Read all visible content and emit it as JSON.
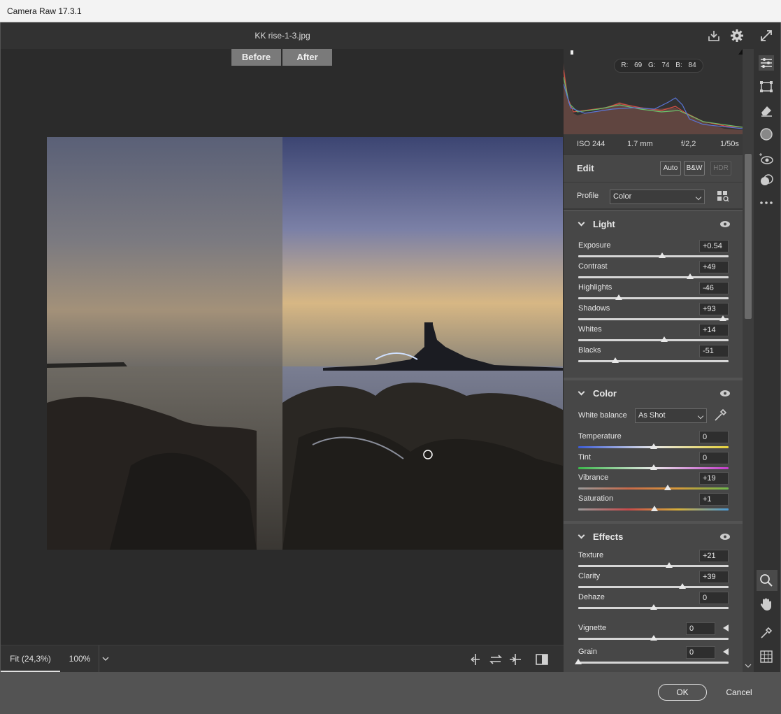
{
  "window": {
    "title": "Camera Raw 17.3.1"
  },
  "topbar": {
    "filename": "KK rise-1-3.jpg",
    "icons": [
      "save-download-icon",
      "settings-gear-icon",
      "fullscreen-icon"
    ]
  },
  "preview": {
    "before_label": "Before",
    "after_label": "After",
    "zoom_fit": "Fit (24,3%)",
    "zoom_100": "100%"
  },
  "histogram": {
    "r_label": "R: 69",
    "g_label": "G: 74",
    "b_label": "B: 84"
  },
  "exif": {
    "iso": "ISO 244",
    "focal": "1.7 mm",
    "aperture": "f/2,2",
    "shutter": "1/50s"
  },
  "edit": {
    "title": "Edit",
    "auto": "Auto",
    "bw": "B&W",
    "hdr": "HDR",
    "profile_label": "Profile",
    "profile_value": "Color"
  },
  "light": {
    "title": "Light",
    "sliders": [
      {
        "label": "Exposure",
        "value": "+0.54",
        "pos": 0.56
      },
      {
        "label": "Contrast",
        "value": "+49",
        "pos": 0.745
      },
      {
        "label": "Highlights",
        "value": "-46",
        "pos": 0.27
      },
      {
        "label": "Shadows",
        "value": "+93",
        "pos": 0.965
      },
      {
        "label": "Whites",
        "value": "+14",
        "pos": 0.57
      },
      {
        "label": "Blacks",
        "value": "-51",
        "pos": 0.245
      }
    ]
  },
  "color": {
    "title": "Color",
    "wb_label": "White balance",
    "wb_value": "As Shot",
    "sliders": [
      {
        "label": "Temperature",
        "value": "0",
        "pos": 0.5
      },
      {
        "label": "Tint",
        "value": "0",
        "pos": 0.5
      },
      {
        "label": "Vibrance",
        "value": "+19",
        "pos": 0.595
      },
      {
        "label": "Saturation",
        "value": "+1",
        "pos": 0.505
      }
    ]
  },
  "effects": {
    "title": "Effects",
    "sliders": [
      {
        "label": "Texture",
        "value": "+21",
        "pos": 0.605
      },
      {
        "label": "Clarity",
        "value": "+39",
        "pos": 0.695
      },
      {
        "label": "Dehaze",
        "value": "0",
        "pos": 0.5
      },
      {
        "label": "Vignette",
        "value": "0",
        "pos": 0.5
      },
      {
        "label": "Grain",
        "value": "0",
        "pos": 0.0
      }
    ]
  },
  "dialog": {
    "ok": "OK",
    "cancel": "Cancel"
  },
  "tools": [
    "edit-sliders-icon",
    "crop-transform-icon",
    "eraser-healing-icon",
    "masking-icon",
    "redeye-icon",
    "presets-icon",
    "more-icon",
    "zoom-icon",
    "hand-icon",
    "color-sampler-icon",
    "grid-icon"
  ]
}
